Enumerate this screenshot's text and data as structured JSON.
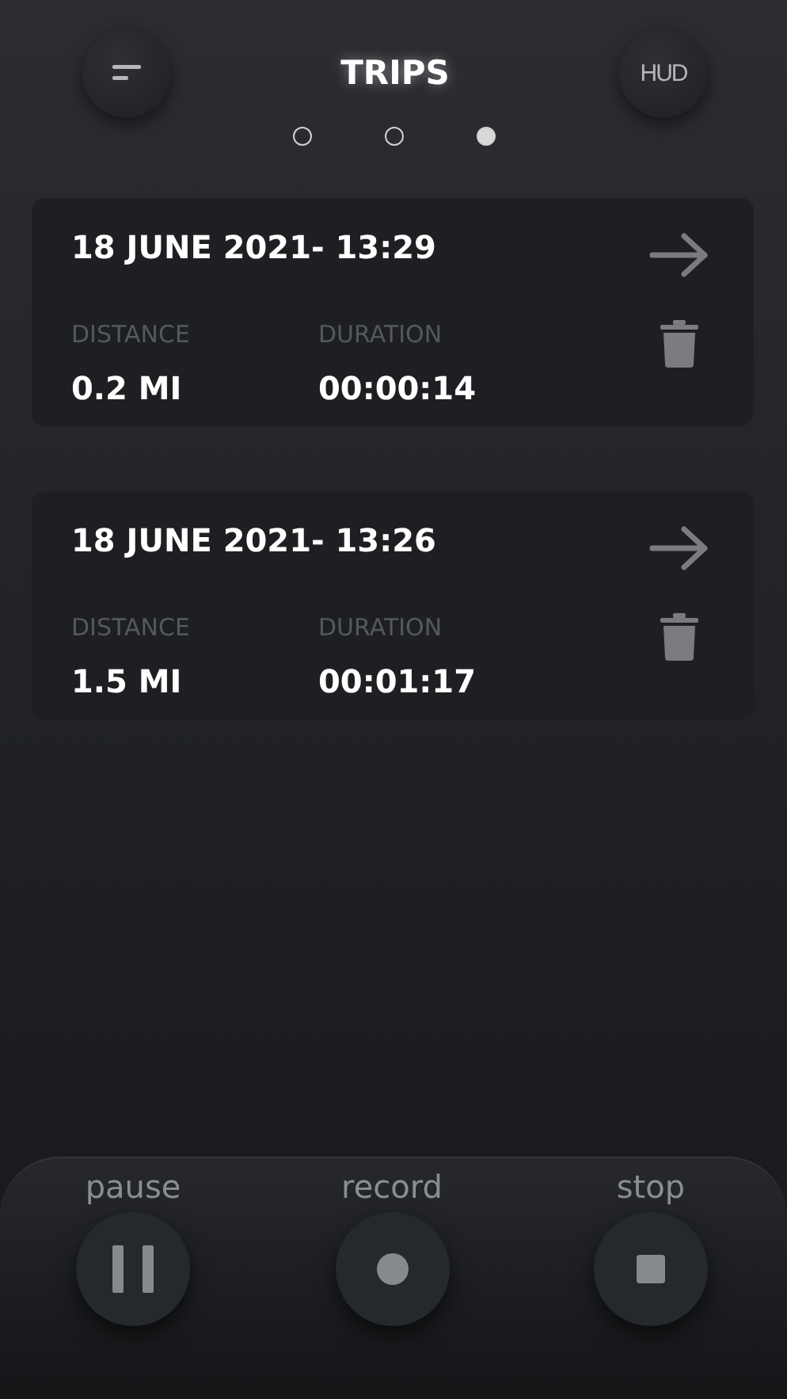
{
  "header": {
    "title": "TRIPS",
    "right_button": "HUD"
  },
  "pages": [
    {
      "selected": false
    },
    {
      "selected": false
    },
    {
      "selected": true
    }
  ],
  "trips": [
    {
      "date": "18 JUNE 2021- 13:29",
      "distance_label": "DISTANCE",
      "distance": "0.2 MI",
      "duration_label": "DURATION",
      "duration": "00:00:14"
    },
    {
      "date": "18 JUNE 2021- 13:26",
      "distance_label": "DISTANCE",
      "distance": "1.5 MI",
      "duration_label": "DURATION",
      "duration": "00:01:17"
    }
  ],
  "controls": [
    {
      "kind": "pause",
      "label": "pause"
    },
    {
      "kind": "record",
      "label": "record"
    },
    {
      "kind": "stop",
      "label": "stop"
    }
  ]
}
